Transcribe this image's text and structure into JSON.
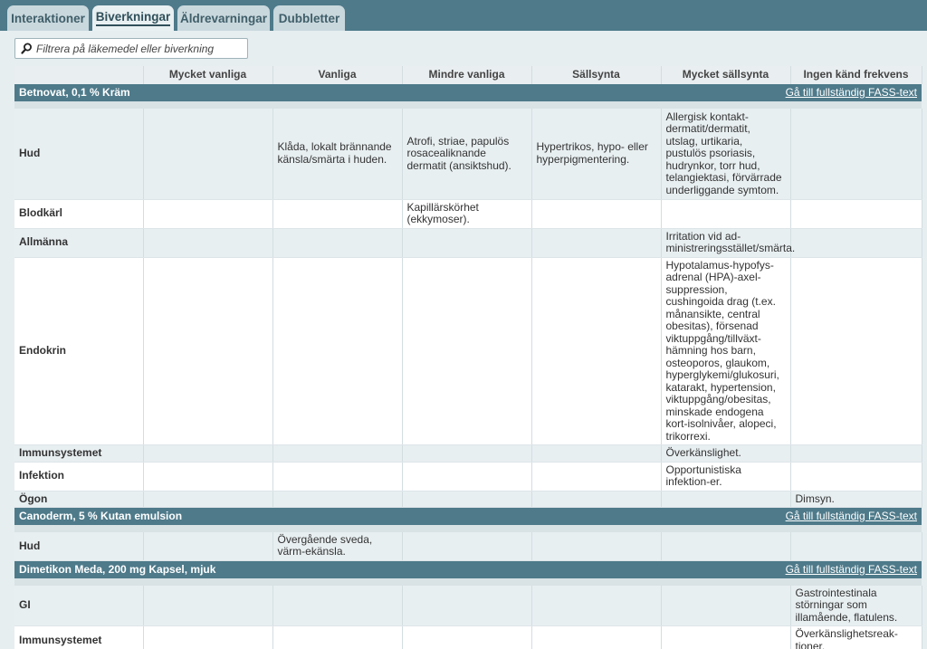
{
  "tabs": [
    {
      "label": "Interaktioner",
      "active": false
    },
    {
      "label": "Biverkningar",
      "active": true
    },
    {
      "label": "Äldrevarningar",
      "active": false
    },
    {
      "label": "Dubbletter",
      "active": false
    }
  ],
  "filter": {
    "placeholder": "Filtrera på läkemedel eller biverkning"
  },
  "columns": [
    "",
    "Mycket vanliga",
    "Vanliga",
    "Mindre vanliga",
    "Sällsynta",
    "Mycket sällsynta",
    "Ingen känd frekvens"
  ],
  "fass_link_label": "Gå till fullständig FASS-text",
  "medicines": [
    {
      "name": "Betnovat, 0,1 % Kräm",
      "rows": [
        {
          "category": "Hud",
          "cells": [
            "",
            "Klåda, lokalt brännande känsla/smärta i huden.",
            "Atrofi, striae, papulös rosacealiknande dermatit (ansiktshud).",
            "Hypertrikos, hypo- eller hyperpigmentering.",
            "Allergisk kontakt-dermatit/dermatit, utslag, urtikaria, pustulös psoriasis, hudrynkor, torr hud, telangiektasi, förvärrade underliggande symtom.",
            ""
          ]
        },
        {
          "category": "Blodkärl",
          "cells": [
            "",
            "",
            "Kapillärskörhet (ekkymoser).",
            "",
            "",
            ""
          ]
        },
        {
          "category": "Allmänna",
          "cells": [
            "",
            "",
            "",
            "",
            "Irritation vid ad-ministreringsstället/smärta.",
            ""
          ]
        },
        {
          "category": "Endokrin",
          "cells": [
            "",
            "",
            "",
            "",
            "Hypotalamus-hypofys-adrenal (HPA)-axel-suppression, cushingoida drag (t.ex. månansikte, central obesitas), försenad viktuppgång/tillväxt-hämning hos barn, osteoporos, glaukom, hyperglykemi/glukosuri, katarakt, hypertension, viktuppgång/obesitas, minskade endogena kort-isolnivåer, alopeci, trikorrexi.",
            ""
          ]
        },
        {
          "category": "Immunsystemet",
          "cells": [
            "",
            "",
            "",
            "",
            "Överkänslighet.",
            ""
          ]
        },
        {
          "category": "Infektion",
          "cells": [
            "",
            "",
            "",
            "",
            "Opportunistiska infektion-er.",
            ""
          ]
        },
        {
          "category": "Ögon",
          "cells": [
            "",
            "",
            "",
            "",
            "",
            "Dimsyn."
          ]
        }
      ]
    },
    {
      "name": "Canoderm, 5 % Kutan emulsion",
      "rows": [
        {
          "category": "Hud",
          "cells": [
            "",
            "Övergående sveda, värm-ekänsla.",
            "",
            "",
            "",
            ""
          ]
        }
      ]
    },
    {
      "name": "Dimetikon Meda, 200 mg Kapsel, mjuk",
      "rows": [
        {
          "category": "GI",
          "cells": [
            "",
            "",
            "",
            "",
            "",
            "Gastrointestinala störningar som illamående, flatulens."
          ]
        },
        {
          "category": "Immunsystemet",
          "cells": [
            "",
            "",
            "",
            "",
            "",
            "Överkänslighetsreak-tioner."
          ]
        }
      ]
    }
  ]
}
